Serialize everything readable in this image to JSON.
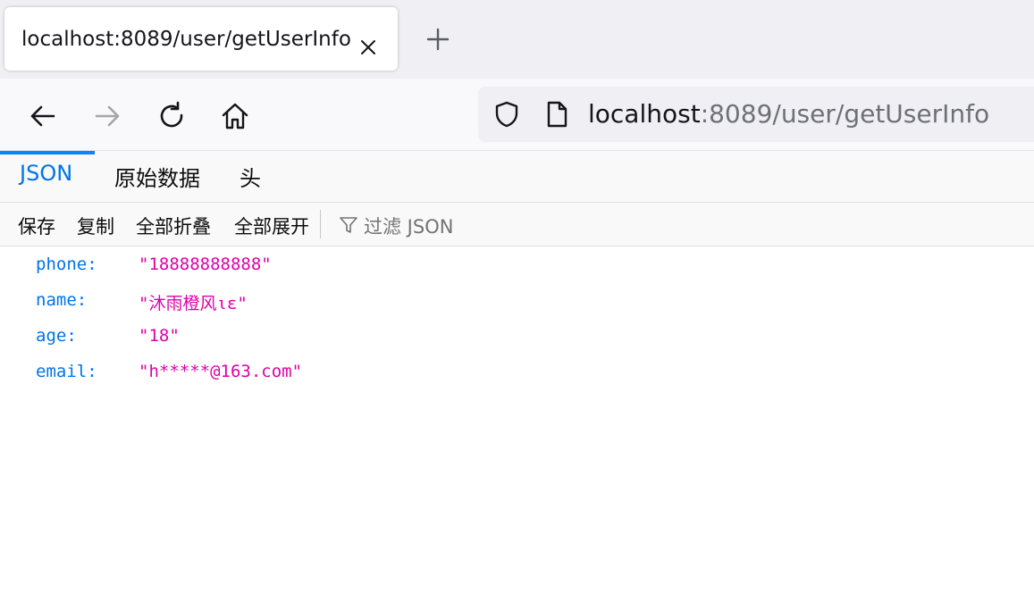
{
  "browser": {
    "tab": {
      "title": "localhost:8089/user/getUserInfo"
    },
    "url": {
      "host": "localhost",
      "rest": ":8089/user/getUserInfo"
    },
    "icons": {
      "close": "close-icon",
      "new_tab": "plus-icon",
      "back": "arrow-left-icon",
      "forward": "arrow-right-icon",
      "reload": "reload-icon",
      "home": "home-icon",
      "shield": "shield-icon",
      "page": "page-icon",
      "filter": "funnel-icon"
    }
  },
  "viewer": {
    "tabs": [
      {
        "label": "JSON",
        "active": true
      },
      {
        "label": "原始数据",
        "active": false
      },
      {
        "label": "头",
        "active": false
      }
    ],
    "toolbar": {
      "save": "保存",
      "copy": "复制",
      "collapse_all": "全部折叠",
      "expand_all": "全部展开",
      "filter_placeholder": "过滤 JSON"
    }
  },
  "json": {
    "rows": [
      {
        "key": "phone:",
        "value": "\"18888888888\""
      },
      {
        "key": "name:",
        "value": "\"沐雨橙风ιε\""
      },
      {
        "key": "age:",
        "value": "\"18\""
      },
      {
        "key": "email:",
        "value": "\"h*****@163.com\""
      }
    ]
  },
  "colors": {
    "accent": "#0a84ff",
    "key": "#0074e8",
    "string": "#dd00a9"
  }
}
